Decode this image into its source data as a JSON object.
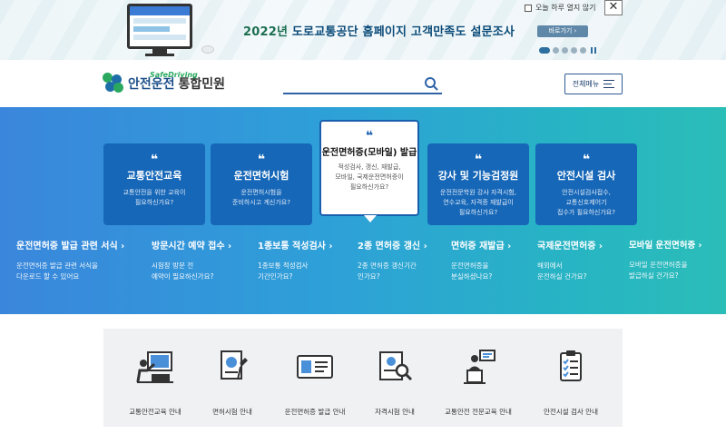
{
  "banner": {
    "title_part1": "2022년 ",
    "title_part2": "도로교통공단 홈페이지 고객만족도 설문조사",
    "checkbox_label": "오늘 하루 열지 않기",
    "close_label": "✕",
    "go_label": "바로가기 ›"
  },
  "header": {
    "logo_sub": "SafeDriving",
    "logo_main": "안전운전",
    "logo_group": "통합민원",
    "search_placeholder": "",
    "all_menu_label": "전체메뉴"
  },
  "hero": {
    "cards": [
      {
        "quote": "❝",
        "title": "교통안전교육",
        "desc_line1": "교통안전을 위한 교육이",
        "desc_line2": "필요하신가요?"
      },
      {
        "quote": "❝",
        "title": "운전면허시험",
        "desc_line1": "운전면허시험을",
        "desc_line2": "준비하시고 계신가요?"
      },
      {
        "quote": "❝",
        "title": "운전면허증(모바일) 발급",
        "desc_line1": "적성검사, 갱신, 재발급,",
        "desc_line2": "모바일, 국제운전면허증이",
        "desc_line3": "필요하신가요?"
      },
      {
        "quote": "❝",
        "title": "강사 및 기능검정원",
        "desc_line1": "운전전문학원 강사 자격시험,",
        "desc_line2": "연수교육, 자격증 재발급이",
        "desc_line3": "필요하신가요?"
      },
      {
        "quote": "❝",
        "title": "안전시설 검사",
        "desc_line1": "안전시설검사접수,",
        "desc_line2": "교통신호제어기",
        "desc_line3": "접수가 필요하신가요?"
      }
    ],
    "links": [
      {
        "title": "운전면허증 발급 관련 서식 ›",
        "desc_line1": "운전면허증 발급 관련 서식을",
        "desc_line2": "다운로드 할 수 있어요"
      },
      {
        "title": "방문시간 예약 접수 ›",
        "desc_line1": "시험장 방문 전",
        "desc_line2": "예약이 필요하신가요?"
      },
      {
        "title": "1종보통 적성검사 ›",
        "desc_line1": "1종보통 적성검사",
        "desc_line2": "기간인가요?"
      },
      {
        "title": "2종 면허증 갱신 ›",
        "desc_line1": "2종 면허증 갱신기간",
        "desc_line2": "인가요?"
      },
      {
        "title": "면허증 재발급 ›",
        "desc_line1": "운전면허증을",
        "desc_line2": "분실하셨나요?"
      },
      {
        "title": "국제운전면허증 ›",
        "desc_line1": "해외에서",
        "desc_line2": "운전하실 건가요?"
      },
      {
        "title": "모바일 운전면허증 ›",
        "desc_line1": "모바일 운전면허증을",
        "desc_line2": "발급하실 건가요?"
      }
    ]
  },
  "services": [
    {
      "label": "교통안전교육 안내",
      "icon": "teacher-board-icon"
    },
    {
      "label": "면허시험 안내",
      "icon": "exam-paper-icon"
    },
    {
      "label": "운전면허증 발급 안내",
      "icon": "license-card-icon"
    },
    {
      "label": "자격시험 안내",
      "icon": "certificate-search-icon"
    },
    {
      "label": "교통안전 전문교육 안내",
      "icon": "lecturer-podium-icon"
    },
    {
      "label": "안전시설 검사 안내",
      "icon": "checklist-icon"
    }
  ]
}
